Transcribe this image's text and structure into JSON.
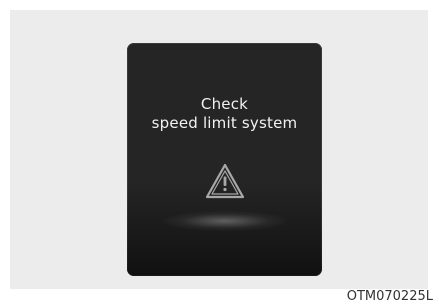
{
  "display": {
    "line1": "Check",
    "line2": "speed limit system",
    "icon": "warning-triangle-icon"
  },
  "figure_code": "OTM070225L",
  "colors": {
    "screen_background": "#252525",
    "text": "#f2f2f2",
    "icon": "#a8a8a8",
    "outer_panel": "#ececec"
  }
}
